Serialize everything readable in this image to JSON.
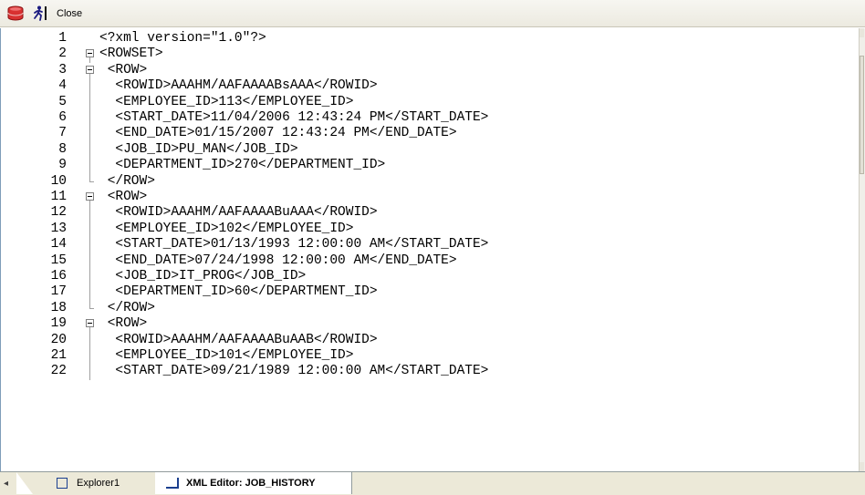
{
  "toolbar": {
    "db_icon": "database-icon",
    "run_icon": "runner-icon",
    "close_label": "Close"
  },
  "editor": {
    "lines": [
      {
        "num": "1",
        "text": "<?xml version=\"1.0\"?>"
      },
      {
        "num": "2",
        "text": "<ROWSET>"
      },
      {
        "num": "3",
        "text": " <ROW>"
      },
      {
        "num": "4",
        "text": "  <ROWID>AAAHM/AAFAAAABsAAA</ROWID>"
      },
      {
        "num": "5",
        "text": "  <EMPLOYEE_ID>113</EMPLOYEE_ID>"
      },
      {
        "num": "6",
        "text": "  <START_DATE>11/04/2006 12:43:24 PM</START_DATE>"
      },
      {
        "num": "7",
        "text": "  <END_DATE>01/15/2007 12:43:24 PM</END_DATE>"
      },
      {
        "num": "8",
        "text": "  <JOB_ID>PU_MAN</JOB_ID>"
      },
      {
        "num": "9",
        "text": "  <DEPARTMENT_ID>270</DEPARTMENT_ID>"
      },
      {
        "num": "10",
        "text": " </ROW>"
      },
      {
        "num": "11",
        "text": " <ROW>"
      },
      {
        "num": "12",
        "text": "  <ROWID>AAAHM/AAFAAAABuAAA</ROWID>"
      },
      {
        "num": "13",
        "text": "  <EMPLOYEE_ID>102</EMPLOYEE_ID>"
      },
      {
        "num": "14",
        "text": "  <START_DATE>01/13/1993 12:00:00 AM</START_DATE>"
      },
      {
        "num": "15",
        "text": "  <END_DATE>07/24/1998 12:00:00 AM</END_DATE>"
      },
      {
        "num": "16",
        "text": "  <JOB_ID>IT_PROG</JOB_ID>"
      },
      {
        "num": "17",
        "text": "  <DEPARTMENT_ID>60</DEPARTMENT_ID>"
      },
      {
        "num": "18",
        "text": " </ROW>"
      },
      {
        "num": "19",
        "text": " <ROW>"
      },
      {
        "num": "20",
        "text": "  <ROWID>AAAHM/AAFAAAABuAAB</ROWID>"
      },
      {
        "num": "21",
        "text": "  <EMPLOYEE_ID>101</EMPLOYEE_ID>"
      },
      {
        "num": "22",
        "text": "  <START_DATE>09/21/1989 12:00:00 AM</START_DATE>"
      }
    ]
  },
  "tabs": [
    {
      "label": "Explorer1",
      "active": false
    },
    {
      "label": "XML Editor: JOB_HISTORY",
      "active": true
    }
  ]
}
